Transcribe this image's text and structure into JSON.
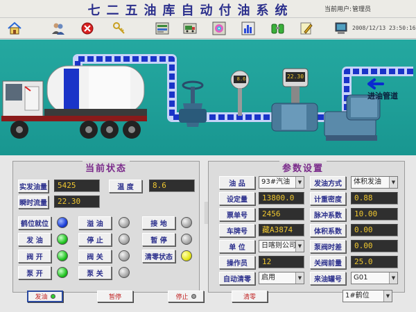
{
  "header": {
    "title": "七二五油库自动付油系统",
    "user_label": "当前用户:",
    "user_value": "管理员",
    "datetime": "2008/12/13 23:50:16.7"
  },
  "toolbar": {
    "icons": [
      "home-icon",
      "users-icon",
      "close-icon",
      "keys-icon",
      "truck-list-icon",
      "truck-icon",
      "disc-icon",
      "bar-chart-icon",
      "tanks-icon",
      "edit-icon",
      "terminal-icon"
    ]
  },
  "scene": {
    "pipe_label": "进油管道",
    "meter1_value": "8.6",
    "meter2_value": "22.30",
    "colors": {
      "background": "#1f9f98",
      "pipe": "#1a34c8",
      "pipe_light": "#c7d3f8"
    }
  },
  "status_panel": {
    "title": "当前状态",
    "actual_volume_label": "实发油量",
    "actual_volume_value": "5425",
    "temperature_label": "温  度",
    "temperature_value": "8.6",
    "flow_label": "瞬时流量",
    "flow_value": "22.30",
    "indicators": [
      {
        "label": "鹤位就位",
        "color": "blue"
      },
      {
        "label": "发  油",
        "color": "green"
      },
      {
        "label": "阀  开",
        "color": "green"
      },
      {
        "label": "泵  开",
        "color": "green"
      },
      {
        "label": "溢  油",
        "color": "gray"
      },
      {
        "label": "停  止",
        "color": "gray"
      },
      {
        "label": "阀  关",
        "color": "gray"
      },
      {
        "label": "泵  关",
        "color": "gray"
      },
      {
        "label": "接  地",
        "color": "gray"
      },
      {
        "label": "暂  停",
        "color": "gray"
      },
      {
        "label": "清零状态",
        "color": "yellow"
      }
    ]
  },
  "params_panel": {
    "title": "参数设置",
    "rows_left": [
      {
        "label": "油  品",
        "value": "93#汽油",
        "type": "select"
      },
      {
        "label": "设定量",
        "value": "13800.0",
        "type": "display"
      },
      {
        "label": "票单号",
        "value": "2456",
        "type": "display"
      },
      {
        "label": "车牌号",
        "value": "藏A3874",
        "type": "display"
      },
      {
        "label": "单  位",
        "value": "日喀则公司",
        "type": "select"
      },
      {
        "label": "操作员",
        "value": "12",
        "type": "display"
      },
      {
        "label": "自动清零",
        "value": "启用",
        "type": "select"
      }
    ],
    "rows_right": [
      {
        "label": "发油方式",
        "value": "体积发油",
        "type": "select"
      },
      {
        "label": "计重密度",
        "value": "0.88",
        "type": "display"
      },
      {
        "label": "脉冲系数",
        "value": "10.00",
        "type": "display"
      },
      {
        "label": "体积系数",
        "value": "0.00",
        "type": "display"
      },
      {
        "label": "泵阀时差",
        "value": "0.00",
        "type": "display"
      },
      {
        "label": "关阀前量",
        "value": "25.0",
        "type": "display"
      },
      {
        "label": "来油罐号",
        "value": "G01",
        "type": "select"
      }
    ]
  },
  "actions": {
    "start_label": "发油",
    "pause_label": "暂停",
    "stop_label": "停止",
    "reset_label": "清零",
    "position_select": "1#鹤位"
  }
}
